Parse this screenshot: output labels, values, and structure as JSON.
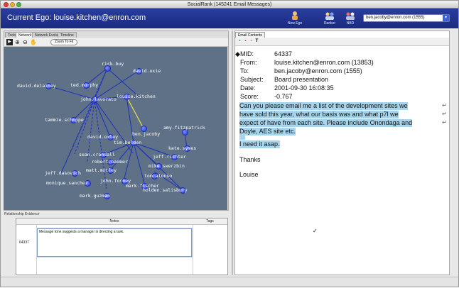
{
  "window": {
    "title": "SocialRank (145241 Email Messages)"
  },
  "header": {
    "ego_label": "Current Ego: louise.kitchen@enron.com",
    "buttons": [
      {
        "label": "New Ego",
        "icon": "new-ego-icon"
      },
      {
        "label": "Ranker",
        "icon": "ranker-icon"
      },
      {
        "label": "NBD",
        "icon": "nbd-icon"
      }
    ],
    "ego_select": "ben.jacoby@enron.com (1555)"
  },
  "left_tabs": [
    "Tools",
    "Network",
    "Network Evolution",
    "Timeline"
  ],
  "left_active_tab": "Network",
  "toolbar": {
    "zoom_to_fit": "Zoom To Fit"
  },
  "graph": {
    "nodes": [
      {
        "id": "rick.buy",
        "label": "rick.buy"
      },
      {
        "id": "david.delainey",
        "label": "david.delainey"
      },
      {
        "id": "ted.murphy",
        "label": "ted.murphy"
      },
      {
        "id": "david.oxley_top",
        "label": "david.oxie"
      },
      {
        "id": "john.lavorato",
        "label": "john.lavorato"
      },
      {
        "id": "louise.kitchen",
        "label": "louise.kitchen"
      },
      {
        "id": "tammie.schoppe",
        "label": "tammie.schoppe"
      },
      {
        "id": "amy.fitzpatrick",
        "label": "amy.fitzpatrick"
      },
      {
        "id": "david.oxley",
        "label": "david.oxley"
      },
      {
        "id": "ben.jacoby",
        "label": "ben.jacoby"
      },
      {
        "id": "kate.symes",
        "label": "kate.symes"
      },
      {
        "id": "tim.belden",
        "label": "tim.belden"
      },
      {
        "id": "sean.crandall",
        "label": "sean.crandall"
      },
      {
        "id": "jeff.richter",
        "label": "jeff.richter"
      },
      {
        "id": "robert.badeer",
        "label": "robert.badeer"
      },
      {
        "id": "mike.swerzbin",
        "label": "mike.swerzbin"
      },
      {
        "id": "jeff.dasovich",
        "label": "jeff.dasovich"
      },
      {
        "id": "matt.motley",
        "label": "matt.motley"
      },
      {
        "id": "tom.alonso",
        "label": "tom.alonso"
      },
      {
        "id": "monique.sanchez",
        "label": "monique.sanchez"
      },
      {
        "id": "john.forney",
        "label": "john.forney"
      },
      {
        "id": "mark.fischer",
        "label": "mark.fischer"
      },
      {
        "id": "mark.guzman",
        "label": "mark.guzman"
      },
      {
        "id": "holden.salisbury",
        "label": "holden.salisbury"
      }
    ]
  },
  "relationship": {
    "title": "Relationship Evidence",
    "columns": [
      "Notes",
      "Tags"
    ],
    "row": {
      "id": "64337",
      "note": "Message tone suggests a manager is directing a task."
    }
  },
  "email": {
    "tab": "Email Contents",
    "fields": [
      {
        "key": "MID:",
        "value": "64337"
      },
      {
        "key": "From:",
        "value": "louise.kitchen@enron.com (13853)"
      },
      {
        "key": "To:",
        "value": "ben.jacoby@enron.com (1555)"
      },
      {
        "key": "Subject:",
        "value": "Board presentation"
      },
      {
        "key": "Date:",
        "value": "2001-09-30 16:08:35"
      },
      {
        "key": "Score:",
        "value": "-0.767"
      }
    ],
    "body_lines": [
      "Can you please email me a list of the development sites we",
      "have sold this year, what our basis was and what p7l we",
      "expect of have from each site.  Please include Onondaga and",
      "Doyle, AES site etc."
    ],
    "body_line5": "I need it asap.",
    "thanks": "Thanks",
    "signature": "Louise"
  },
  "colors": {
    "header": "#1f2f8a",
    "graph_bg": "#5e7186",
    "highlight": "#a8d4ec",
    "node": "#2438d8",
    "ego_edge": "#f2e24a"
  }
}
